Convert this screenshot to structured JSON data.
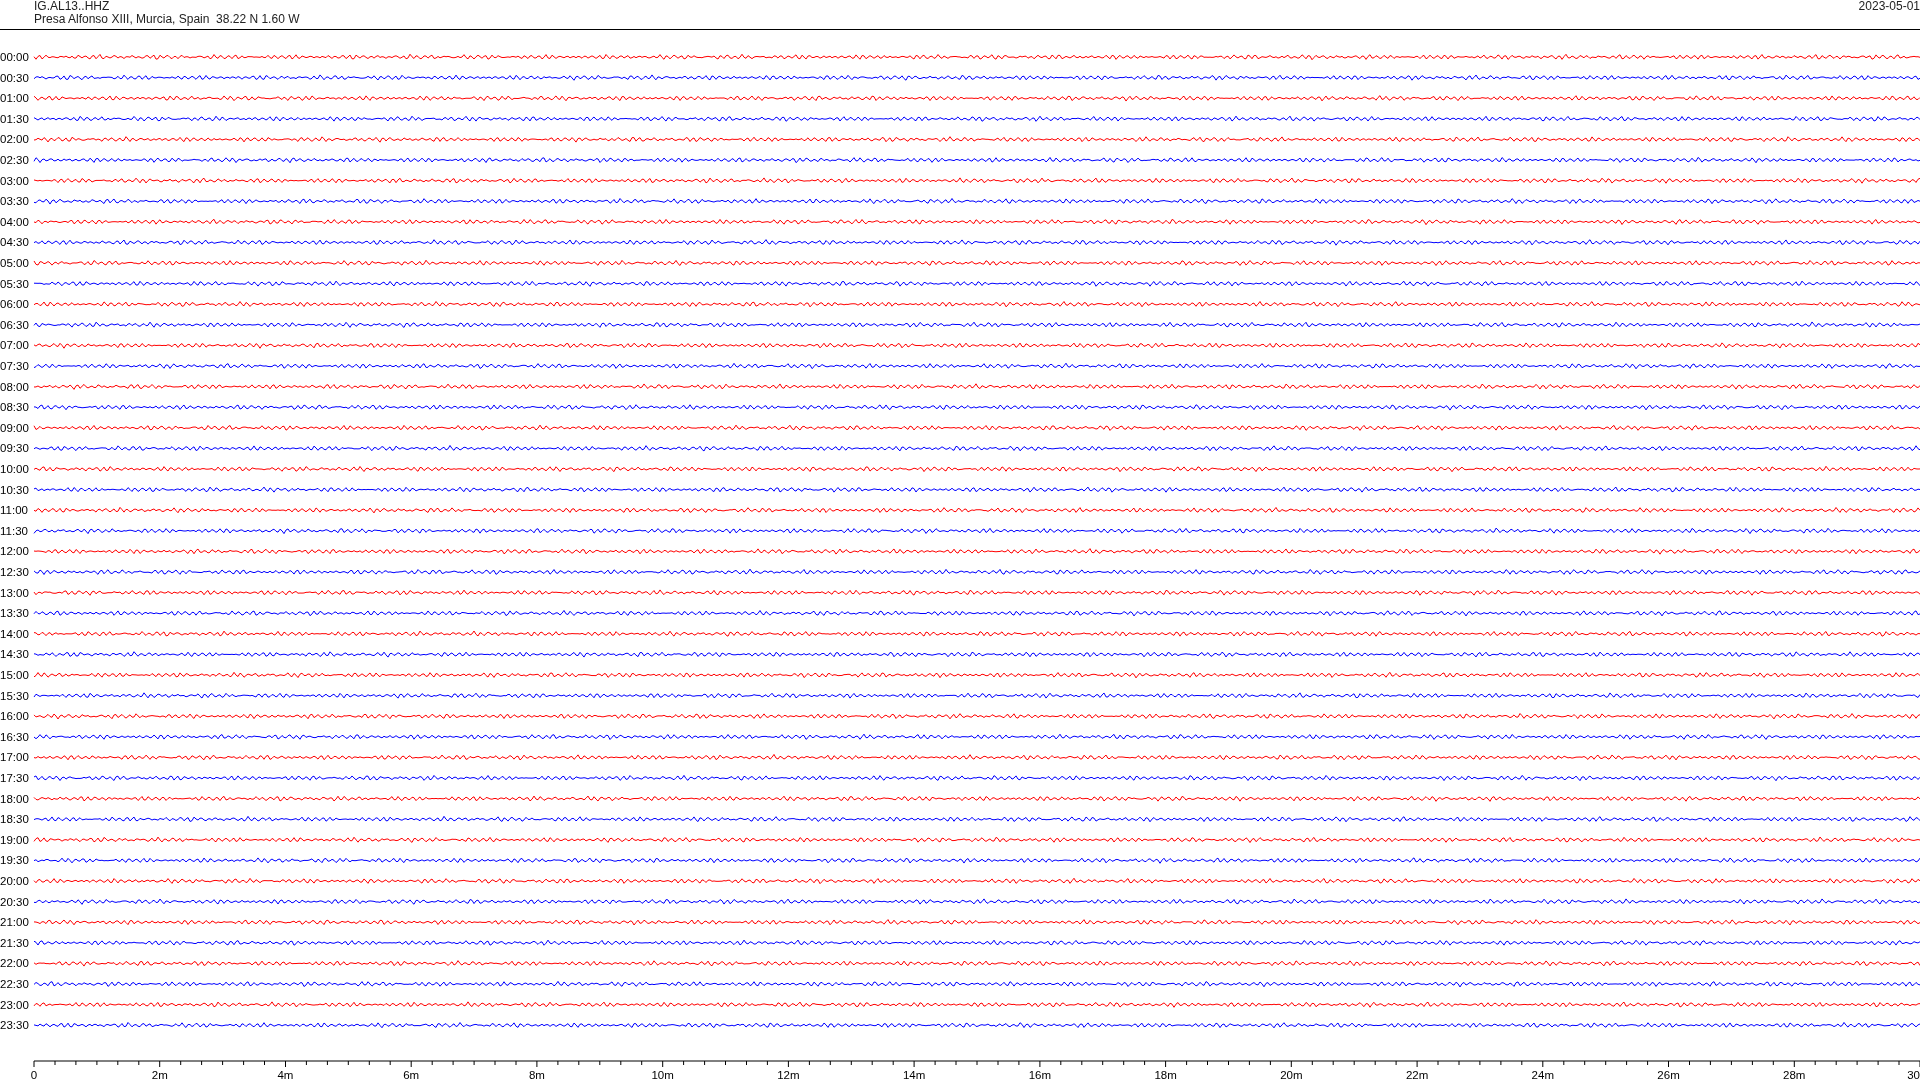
{
  "header": {
    "station": "IG.AL13..HHZ",
    "location": "Presa Alfonso XIII, Murcia, Spain  38.22 N 1.60 W",
    "date": "2023-05-01"
  },
  "rows": [
    {
      "time": "00:00",
      "color": "#ff0000"
    },
    {
      "time": "00:30",
      "color": "#0000ff"
    },
    {
      "time": "01:00",
      "color": "#ff0000"
    },
    {
      "time": "01:30",
      "color": "#0000ff"
    },
    {
      "time": "02:00",
      "color": "#ff0000"
    },
    {
      "time": "02:30",
      "color": "#0000ff"
    },
    {
      "time": "03:00",
      "color": "#ff0000"
    },
    {
      "time": "03:30",
      "color": "#0000ff"
    },
    {
      "time": "04:00",
      "color": "#ff0000"
    },
    {
      "time": "04:30",
      "color": "#0000ff"
    },
    {
      "time": "05:00",
      "color": "#ff0000"
    },
    {
      "time": "05:30",
      "color": "#0000ff"
    },
    {
      "time": "06:00",
      "color": "#ff0000"
    },
    {
      "time": "06:30",
      "color": "#0000ff"
    },
    {
      "time": "07:00",
      "color": "#ff0000"
    },
    {
      "time": "07:30",
      "color": "#0000ff"
    },
    {
      "time": "08:00",
      "color": "#ff0000"
    },
    {
      "time": "08:30",
      "color": "#0000ff"
    },
    {
      "time": "09:00",
      "color": "#ff0000"
    },
    {
      "time": "09:30",
      "color": "#0000ff"
    },
    {
      "time": "10:00",
      "color": "#ff0000"
    },
    {
      "time": "10:30",
      "color": "#0000ff"
    },
    {
      "time": "11:00",
      "color": "#ff0000"
    },
    {
      "time": "11:30",
      "color": "#0000ff"
    },
    {
      "time": "12:00",
      "color": "#ff0000"
    },
    {
      "time": "12:30",
      "color": "#0000ff"
    },
    {
      "time": "13:00",
      "color": "#ff0000"
    },
    {
      "time": "13:30",
      "color": "#0000ff"
    },
    {
      "time": "14:00",
      "color": "#ff0000"
    },
    {
      "time": "14:30",
      "color": "#0000ff"
    },
    {
      "time": "15:00",
      "color": "#ff0000"
    },
    {
      "time": "15:30",
      "color": "#0000ff"
    },
    {
      "time": "16:00",
      "color": "#ff0000"
    },
    {
      "time": "16:30",
      "color": "#0000ff"
    },
    {
      "time": "17:00",
      "color": "#ff0000"
    },
    {
      "time": "17:30",
      "color": "#0000ff"
    },
    {
      "time": "18:00",
      "color": "#ff0000"
    },
    {
      "time": "18:30",
      "color": "#0000ff"
    },
    {
      "time": "19:00",
      "color": "#ff0000"
    },
    {
      "time": "19:30",
      "color": "#0000ff"
    },
    {
      "time": "20:00",
      "color": "#ff0000"
    },
    {
      "time": "20:30",
      "color": "#0000ff"
    },
    {
      "time": "21:00",
      "color": "#ff0000"
    },
    {
      "time": "21:30",
      "color": "#0000ff"
    },
    {
      "time": "22:00",
      "color": "#ff0000"
    },
    {
      "time": "22:30",
      "color": "#0000ff"
    },
    {
      "time": "23:00",
      "color": "#ff0000"
    },
    {
      "time": "23:30",
      "color": "#0000ff"
    }
  ],
  "x_axis": {
    "ticks": [
      "0",
      "2m",
      "4m",
      "6m",
      "8m",
      "10m",
      "12m",
      "14m",
      "16m",
      "18m",
      "20m",
      "22m",
      "24m",
      "26m",
      "28m",
      "30"
    ]
  }
}
